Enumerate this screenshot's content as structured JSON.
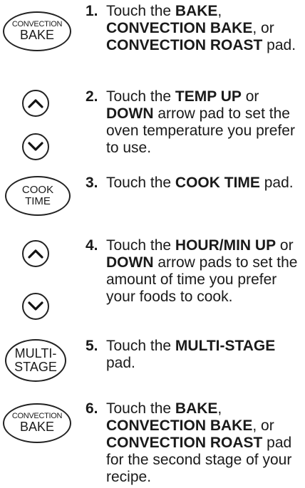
{
  "steps": [
    {
      "num": "1.",
      "icon": {
        "type": "convection-bake-pad",
        "line1": "CONVECTION",
        "line2": "BAKE"
      },
      "parts": [
        {
          "t": "Touch the ",
          "b": false
        },
        {
          "t": "BAKE",
          "b": true
        },
        {
          "t": ", ",
          "b": false
        },
        {
          "t": "CONVECTION BAKE",
          "b": true
        },
        {
          "t": ", or ",
          "b": false
        },
        {
          "t": "CONVECTION ROAST",
          "b": true
        },
        {
          "t": " pad.",
          "b": false
        }
      ]
    },
    {
      "num": "2.",
      "icon": {
        "type": "up-down-arrow-pads"
      },
      "parts": [
        {
          "t": "Touch the ",
          "b": false
        },
        {
          "t": "TEMP UP",
          "b": true
        },
        {
          "t": " or ",
          "b": false
        },
        {
          "t": "DOWN",
          "b": true
        },
        {
          "t": " arrow pad to set the oven temperature you prefer to use.",
          "b": false
        }
      ]
    },
    {
      "num": "3.",
      "icon": {
        "type": "cook-time-pad",
        "line1": "COOK",
        "line2": "TIME"
      },
      "parts": [
        {
          "t": "Touch the ",
          "b": false
        },
        {
          "t": "COOK TIME",
          "b": true
        },
        {
          "t": " pad.",
          "b": false
        }
      ]
    },
    {
      "num": "4.",
      "icon": {
        "type": "up-down-arrow-pads"
      },
      "parts": [
        {
          "t": "Touch the ",
          "b": false
        },
        {
          "t": "HOUR/MIN UP",
          "b": true
        },
        {
          "t": " or ",
          "b": false
        },
        {
          "t": "DOWN",
          "b": true
        },
        {
          "t": " arrow pads to set the amount of time you prefer your foods to cook.",
          "b": false
        }
      ]
    },
    {
      "num": "5.",
      "icon": {
        "type": "multi-stage-pad",
        "line1": "MULTI-",
        "line2": "STAGE"
      },
      "parts": [
        {
          "t": "Touch the ",
          "b": false
        },
        {
          "t": "MULTI-STAGE",
          "b": true
        },
        {
          "t": " pad.",
          "b": false
        }
      ]
    },
    {
      "num": "6.",
      "icon": {
        "type": "convection-bake-pad",
        "line1": "CONVECTION",
        "line2": "BAKE"
      },
      "parts": [
        {
          "t": "Touch the ",
          "b": false
        },
        {
          "t": "BAKE",
          "b": true
        },
        {
          "t": ", ",
          "b": false
        },
        {
          "t": "CONVECTION BAKE",
          "b": true
        },
        {
          "t": ", or ",
          "b": false
        },
        {
          "t": "CONVECTION ROAST",
          "b": true
        },
        {
          "t": " pad for the second stage of your recipe.",
          "b": false
        }
      ]
    }
  ]
}
